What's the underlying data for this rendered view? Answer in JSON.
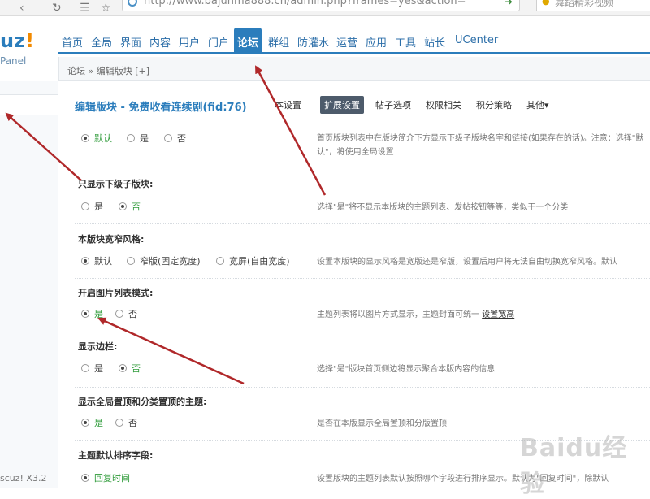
{
  "browser": {
    "url": "http://www.bajunma888.cn/admin.php?frames=yes&action=",
    "search_text": "舞蹈精彩视频"
  },
  "logo": {
    "brand_plain": "uz",
    "brand_accent": "!",
    "subtitle": "Panel"
  },
  "topnav": {
    "tabs": [
      "首页",
      "全局",
      "界面",
      "内容",
      "用户",
      "门户",
      "论坛",
      "群组",
      "防灌水",
      "运营",
      "应用",
      "工具",
      "站长",
      "UCenter"
    ],
    "active": "论坛"
  },
  "breadcrumb": "论坛 » 编辑版块 [+]",
  "sidebar": {
    "version": "scuz! X3.2"
  },
  "page": {
    "title": "编辑版块 - 免费收看连续剧(fid:76)",
    "subtabs": [
      "本设置",
      "扩展设置",
      "帖子选项",
      "权限相关",
      "积分策略",
      "其他▾"
    ],
    "active_subtab": "扩展设置"
  },
  "settings": [
    {
      "label": "",
      "options": [
        {
          "text": "默认",
          "checked": true
        },
        {
          "text": "是",
          "checked": false
        },
        {
          "text": "否",
          "checked": false
        }
      ],
      "tip": "首页版块列表中在版块简介下方显示下级子版块名字和链接(如果存在的话)。注意：选择\"默认\"，将使用全局设置"
    },
    {
      "label": "只显示下级子版块:",
      "options": [
        {
          "text": "是",
          "checked": false
        },
        {
          "text": "否",
          "checked": true
        }
      ],
      "tip": "选择\"是\"将不显示本版块的主题列表、发帖按钮等等，类似于一个分类"
    },
    {
      "label": "本版块宽窄风格:",
      "options": [
        {
          "text": "默认",
          "checked": true
        },
        {
          "text": "窄版(固定宽度)",
          "checked": false
        },
        {
          "text": "宽屏(自由宽度)",
          "checked": false
        }
      ],
      "tip": "设置本版块的显示风格是宽版还是窄版，设置后用户将无法自由切换宽窄风格。默认"
    },
    {
      "label": "开启图片列表模式:",
      "options": [
        {
          "text": "是",
          "checked": true
        },
        {
          "text": "否",
          "checked": false
        }
      ],
      "tip": "主题列表将以图片方式显示，主题封面可统一",
      "tip_link": "设置宽高"
    },
    {
      "label": "显示边栏:",
      "options": [
        {
          "text": "是",
          "checked": false
        },
        {
          "text": "否",
          "checked": true
        }
      ],
      "tip": "选择\"是\"版块首页侧边将显示聚合本版内容的信息"
    },
    {
      "label": "显示全局置顶和分类置顶的主题:",
      "options": [
        {
          "text": "是",
          "checked": true
        },
        {
          "text": "否",
          "checked": false
        }
      ],
      "tip": "是否在本版显示全局置顶和分版置顶"
    },
    {
      "label": "主题默认排序字段:",
      "options": [
        {
          "text": "回复时间",
          "checked": true
        }
      ],
      "tip": "设置版块的主题列表默认按照哪个字段进行排序显示。默认为\"回复时间\"，除默认"
    }
  ],
  "watermark": "Baidu经验",
  "colors": {
    "accent": "#2b7dbc",
    "arrow": "#b0282a",
    "checked_text": "#2f9b3a"
  }
}
